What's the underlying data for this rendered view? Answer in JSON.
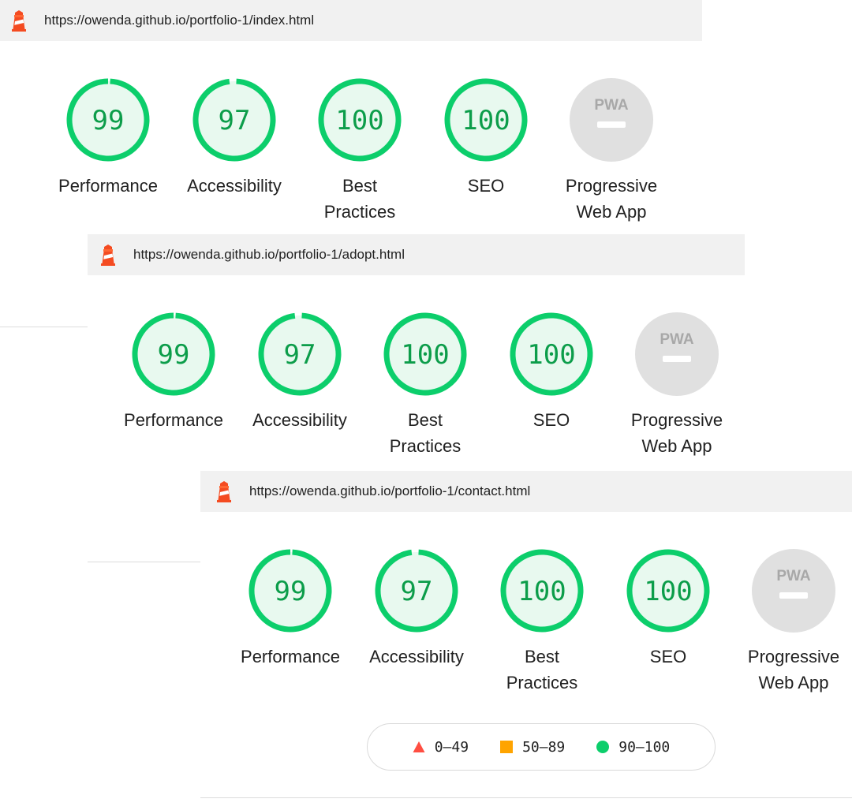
{
  "colors": {
    "pass": "#0cce6b",
    "pass_text": "#0c9d4a",
    "pass_fill": "#e8f9ef",
    "average": "#ffa400",
    "fail": "#ff4e42",
    "pwa_gray": "#e0e0e0",
    "urlbar_bg": "#f1f1f1"
  },
  "reports": [
    {
      "url": "https://owenda.github.io/portfolio-1/index.html",
      "categories": [
        {
          "score": "99",
          "label_line1": "Performance",
          "label_line2": ""
        },
        {
          "score": "97",
          "label_line1": "Accessibility",
          "label_line2": ""
        },
        {
          "score": "100",
          "label_line1": "Best",
          "label_line2": "Practices"
        },
        {
          "score": "100",
          "label_line1": "SEO",
          "label_line2": ""
        }
      ],
      "pwa": {
        "badge": "PWA",
        "label_line1": "Progressive",
        "label_line2": "Web App"
      }
    },
    {
      "url": "https://owenda.github.io/portfolio-1/adopt.html",
      "categories": [
        {
          "score": "99",
          "label_line1": "Performance",
          "label_line2": ""
        },
        {
          "score": "97",
          "label_line1": "Accessibility",
          "label_line2": ""
        },
        {
          "score": "100",
          "label_line1": "Best",
          "label_line2": "Practices"
        },
        {
          "score": "100",
          "label_line1": "SEO",
          "label_line2": ""
        }
      ],
      "pwa": {
        "badge": "PWA",
        "label_line1": "Progressive",
        "label_line2": "Web App"
      }
    },
    {
      "url": "https://owenda.github.io/portfolio-1/contact.html",
      "categories": [
        {
          "score": "99",
          "label_line1": "Performance",
          "label_line2": ""
        },
        {
          "score": "97",
          "label_line1": "Accessibility",
          "label_line2": ""
        },
        {
          "score": "100",
          "label_line1": "Best",
          "label_line2": "Practices"
        },
        {
          "score": "100",
          "label_line1": "SEO",
          "label_line2": ""
        }
      ],
      "pwa": {
        "badge": "PWA",
        "label_line1": "Progressive",
        "label_line2": "Web App"
      }
    }
  ],
  "legend": {
    "fail_range": "0–49",
    "average_range": "50–89",
    "pass_range": "90–100"
  },
  "icons": {
    "logo": "lighthouse-icon",
    "fail": "triangle-icon",
    "average": "square-icon",
    "pass": "circle-icon"
  }
}
